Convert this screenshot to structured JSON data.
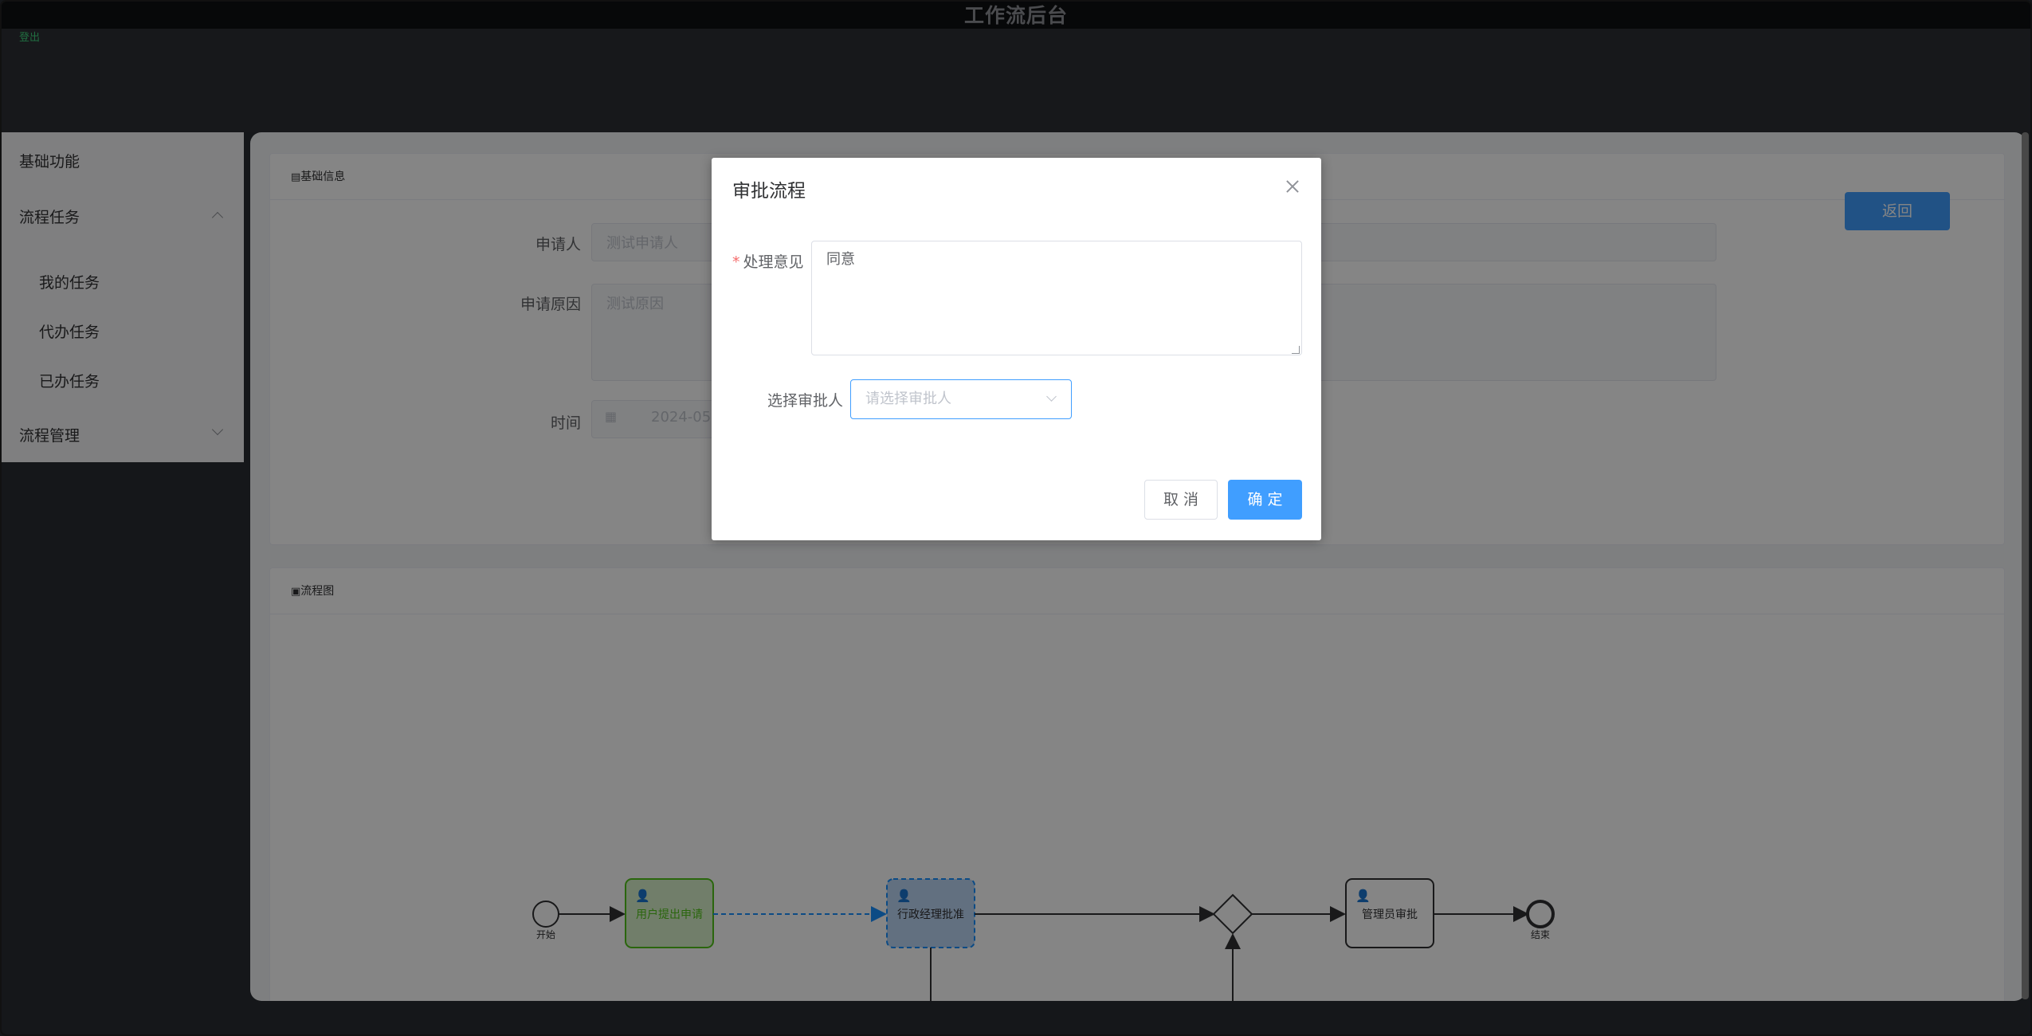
{
  "app": {
    "title": "工作流后台",
    "login_link": "登出"
  },
  "sidebar": {
    "items": [
      {
        "label": "基础功能"
      },
      {
        "label": "流程任务",
        "expanded": true,
        "children": [
          {
            "label": "我的任务"
          },
          {
            "label": "代办任务"
          },
          {
            "label": "已办任务"
          }
        ]
      },
      {
        "label": "流程管理",
        "expanded": false
      }
    ]
  },
  "basic_info": {
    "header": "基础信息",
    "back_label": "返回",
    "applicant_label": "申请人",
    "applicant_value": "测试申请人",
    "reason_label": "申请原因",
    "reason_value": "测试原因",
    "time_label": "时间",
    "time_value": "2024-05-06"
  },
  "flowchart": {
    "header": "流程图",
    "start_label": "开始",
    "end_label": "结束",
    "task_user_apply": "用户提出申请",
    "task_manager_approve": "行政经理批准",
    "task_admin_approve": "管理员审批",
    "colors": {
      "completed": "#52c41a",
      "current": "#1890ff",
      "pending": "#303133"
    }
  },
  "dialog": {
    "title": "审批流程",
    "opinion_label": "处理意见",
    "opinion_value": "同意",
    "approver_label": "选择审批人",
    "approver_placeholder": "请选择审批人",
    "cancel_label": "取 消",
    "confirm_label": "确 定"
  }
}
